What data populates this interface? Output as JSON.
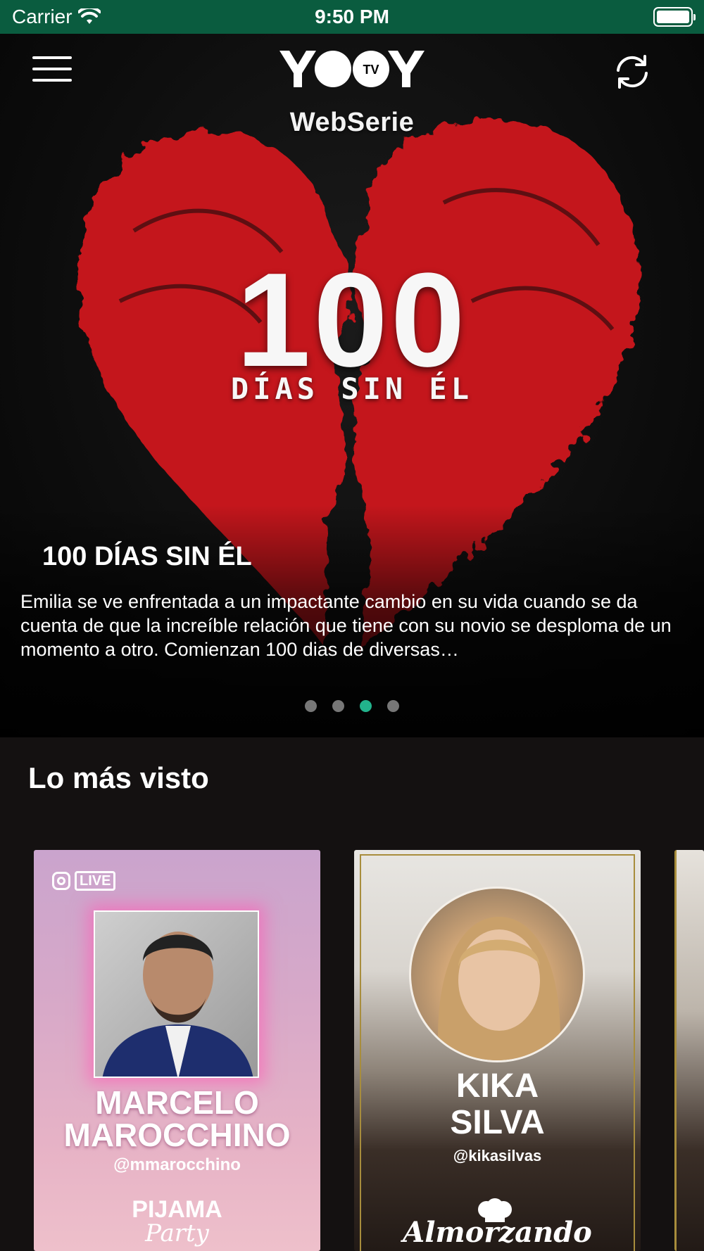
{
  "status_bar": {
    "carrier": "Carrier",
    "time": "9:50 PM",
    "icons": [
      "wifi-icon",
      "battery-icon"
    ]
  },
  "header": {
    "menu_icon": "hamburger-menu-icon",
    "logo": "YOOY TV",
    "logo_badge": "TV",
    "refresh_icon": "refresh-icon"
  },
  "hero": {
    "category": "WebSerie",
    "art_number": "100",
    "art_subtitle": "DÍAS SIN ÉL",
    "title": "100 DÍAS SIN ÉL",
    "description": "Emilia se ve enfrentada a un impactante cambio en su vida cuando se da cuenta de que la increíble relación que tiene con su novio se desploma de un momento a otro. Comienzan 100 dias de diversas…",
    "pages": 4,
    "active_page": 3,
    "colors": {
      "heart": "#c4141a",
      "accent": "#22b38c"
    }
  },
  "section": {
    "title": "Lo más visto"
  },
  "cards": [
    {
      "badge": "LIVE",
      "badge_icon": "instagram-icon",
      "name_line1": "MARCELO",
      "name_line2": "MAROCCHINO",
      "handle": "@mmarocchino",
      "show_line1": "PIJAMA",
      "show_line2": "Party"
    },
    {
      "name_line1": "KIKA",
      "name_line2": "SILVA",
      "handle": "@kikasilvas",
      "show": "Almorzando",
      "show_icon": "chef-hat-icon"
    }
  ]
}
